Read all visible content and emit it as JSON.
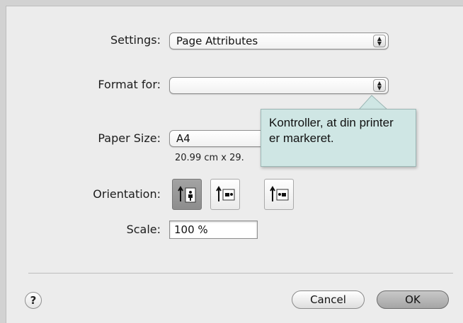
{
  "settings": {
    "label": "Settings:",
    "value": "Page Attributes"
  },
  "format": {
    "label": "Format for:",
    "value": ""
  },
  "paper": {
    "label": "Paper Size:",
    "value": "A4",
    "dimensions": "20.99 cm x 29."
  },
  "orientation": {
    "label": "Orientation:",
    "options": [
      {
        "name": "portrait",
        "selected": true
      },
      {
        "name": "landscape-left",
        "selected": false
      },
      {
        "name": "landscape-right",
        "selected": false
      }
    ]
  },
  "scale": {
    "label": "Scale:",
    "value": "100 %"
  },
  "tooltip": {
    "line1": "Kontroller, at din printer",
    "line2": "er markeret."
  },
  "buttons": {
    "help": "?",
    "cancel": "Cancel",
    "ok": "OK"
  },
  "colors": {
    "tooltip_bg": "#cfe6e4",
    "dialog_bg": "#ececec"
  }
}
